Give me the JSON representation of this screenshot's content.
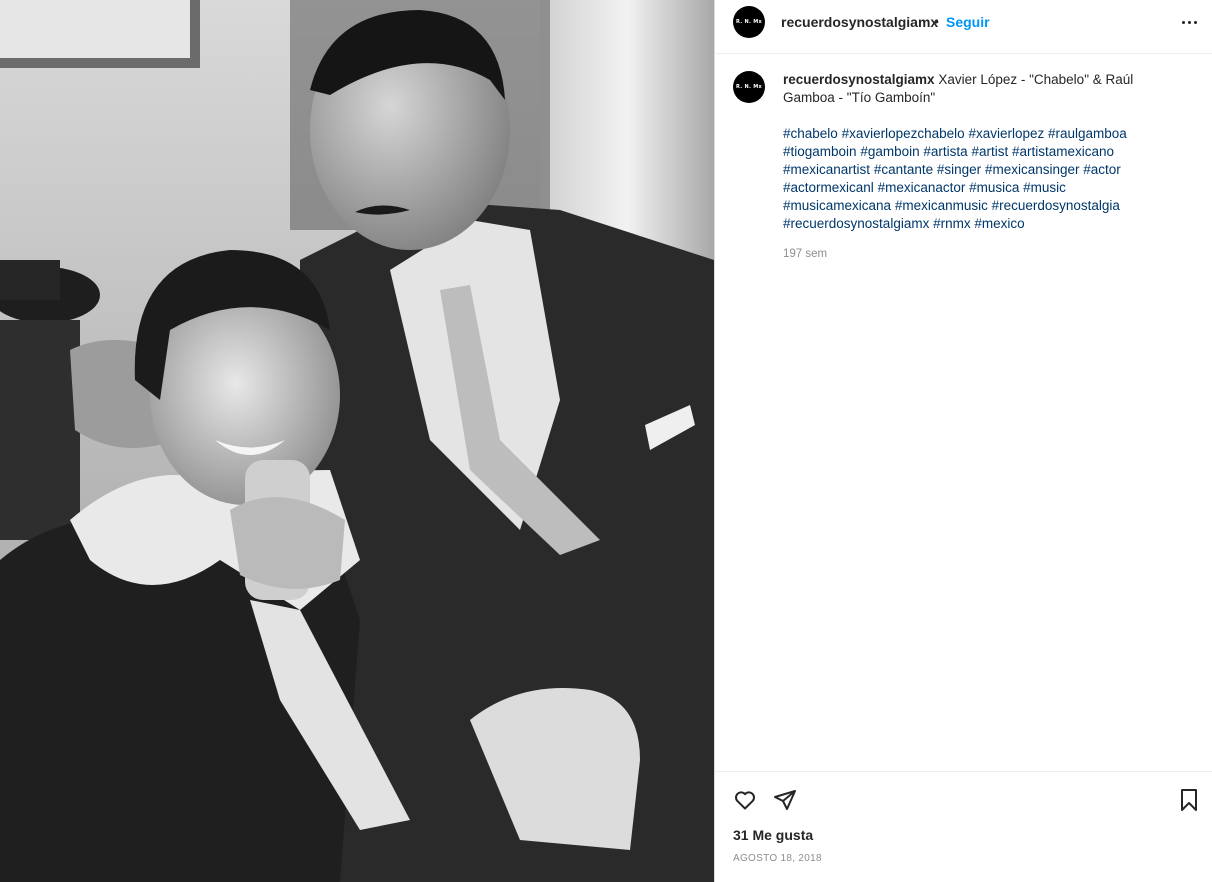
{
  "photo": {
    "alt": "Black and white photograph"
  },
  "header": {
    "avatar_text": "R. N. Mx",
    "username": "recuerdosynostalgiamx",
    "separator": "•",
    "follow_label": "Seguir",
    "more_icon": "more-options-icon"
  },
  "post": {
    "avatar_text": "R. N. Mx",
    "username": "recuerdosynostalgiamx",
    "caption_line1": " Xavier López - \"Chabelo\" & Raúl",
    "caption_line2": "Gamboa - \"Tío Gamboín\"",
    "hashtags": [
      "#chabelo",
      "#xavierlopezchabelo",
      "#xavierlopez",
      "#raulgamboa",
      "#tiogamboin",
      "#gamboin",
      "#artista",
      "#artist",
      "#artistamexicano",
      "#mexicanartist",
      "#cantante",
      "#singer",
      "#mexicansinger",
      "#actor",
      "#actormexicanl",
      "#mexicanactor",
      "#musica",
      "#music",
      "#musicamexicana",
      "#mexicanmusic",
      "#recuerdosynostalgia",
      "#recuerdosynostalgiamx",
      "#rnmx",
      "#mexico"
    ],
    "time_ago": "197 sem"
  },
  "actions": {
    "like_icon": "heart-icon",
    "share_icon": "send-icon",
    "save_icon": "bookmark-icon",
    "likes": "31 Me gusta",
    "date": "AGOSTO 18, 2018"
  },
  "colors": {
    "link": "#00376b",
    "follow": "#0095f6",
    "muted": "#8e8e8e",
    "text": "#262626"
  }
}
